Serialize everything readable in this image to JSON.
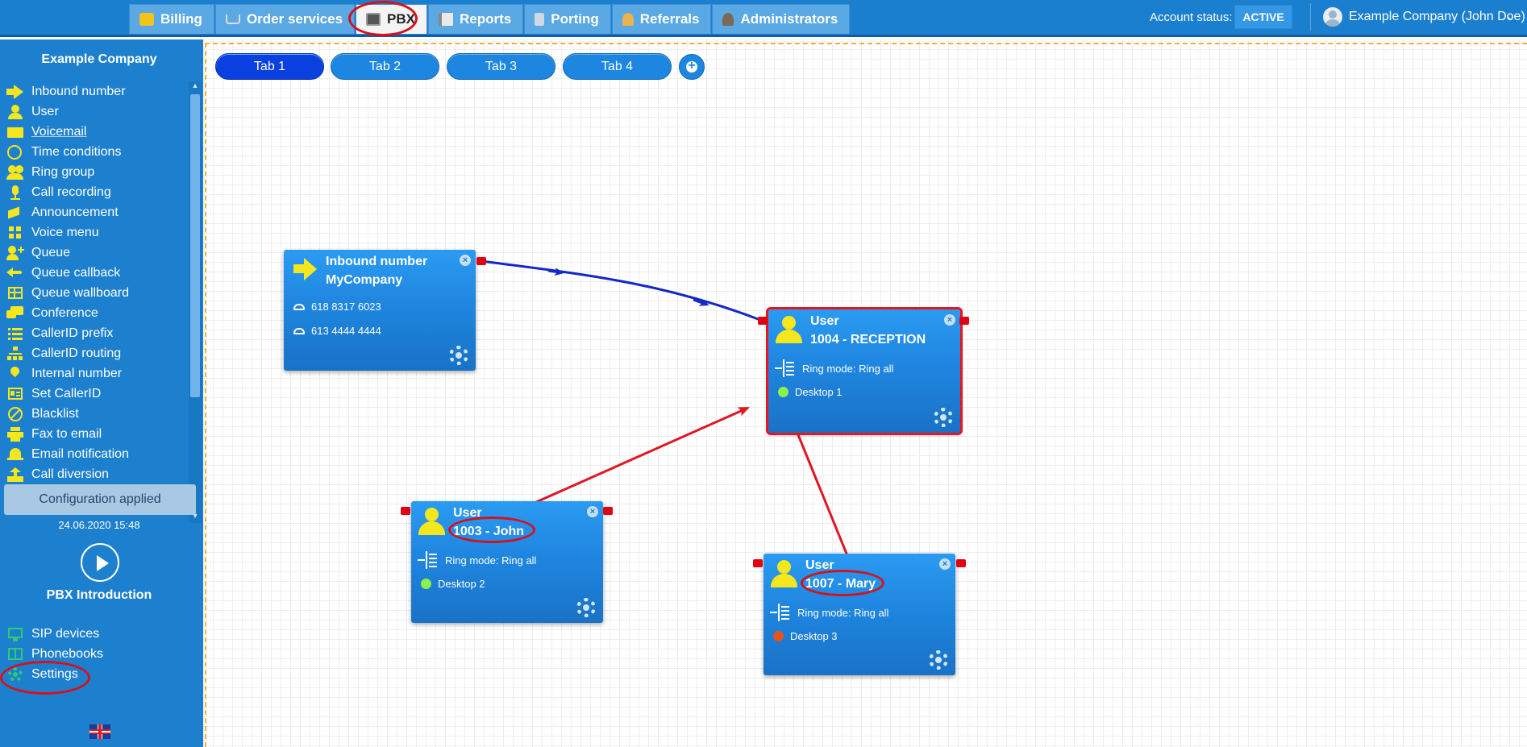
{
  "top_tabs": [
    {
      "label": "Billing",
      "icon": "billing-icon"
    },
    {
      "label": "Order services",
      "icon": "cart-icon"
    },
    {
      "label": "PBX",
      "icon": "pbx-icon"
    },
    {
      "label": "Reports",
      "icon": "reports-icon"
    },
    {
      "label": "Porting",
      "icon": "porting-icon"
    },
    {
      "label": "Referrals",
      "icon": "referrals-icon"
    },
    {
      "label": "Administrators",
      "icon": "administrators-icon"
    }
  ],
  "active_top_tab": "PBX",
  "account": {
    "label": "Account status:",
    "status": "ACTIVE",
    "user": "Example Company (John Doe)"
  },
  "sidebar": {
    "title": "Example Company",
    "items": [
      {
        "label": "Inbound number",
        "icon": "arrow-right-icon"
      },
      {
        "label": "User",
        "icon": "user-icon"
      },
      {
        "label": "Voicemail",
        "icon": "envelope-icon"
      },
      {
        "label": "Time conditions",
        "icon": "clock-icon"
      },
      {
        "label": "Ring group",
        "icon": "users-icon"
      },
      {
        "label": "Call recording",
        "icon": "microphone-icon"
      },
      {
        "label": "Announcement",
        "icon": "megaphone-icon"
      },
      {
        "label": "Voice menu",
        "icon": "grid-icon"
      },
      {
        "label": "Queue",
        "icon": "user-plus-icon"
      },
      {
        "label": "Queue callback",
        "icon": "reply-icon"
      },
      {
        "label": "Queue wallboard",
        "icon": "table-icon"
      },
      {
        "label": "Conference",
        "icon": "chat-icon"
      },
      {
        "label": "CallerID prefix",
        "icon": "list-icon"
      },
      {
        "label": "CallerID routing",
        "icon": "sitemap-icon"
      },
      {
        "label": "Internal number",
        "icon": "map-pin-icon"
      },
      {
        "label": "Set CallerID",
        "icon": "id-card-icon"
      },
      {
        "label": "Blacklist",
        "icon": "ban-icon"
      },
      {
        "label": "Fax to email",
        "icon": "printer-icon"
      },
      {
        "label": "Email notification",
        "icon": "bell-icon"
      },
      {
        "label": "Call diversion",
        "icon": "upload-icon"
      }
    ],
    "config_button": "Configuration applied",
    "config_time": "24.06.2020 15:48",
    "intro_label": "PBX Introduction",
    "bottom_items": [
      {
        "label": "SIP devices",
        "icon": "monitor-icon"
      },
      {
        "label": "Phonebooks",
        "icon": "book-icon"
      },
      {
        "label": "Settings",
        "icon": "gear-icon"
      }
    ],
    "language_icon": "uk-flag-icon"
  },
  "canvas_tabs": [
    "Tab 1",
    "Tab 2",
    "Tab 3",
    "Tab 4"
  ],
  "active_canvas_tab": "Tab 1",
  "nodes": {
    "inbound": {
      "title": "Inbound number",
      "name": "MyCompany",
      "numbers": [
        "618 8317 6023",
        "613 4444 4444"
      ]
    },
    "reception": {
      "title": "User",
      "name": "1004 - RECEPTION",
      "ring_mode": "Ring mode: Ring all",
      "device": "Desktop 1",
      "device_status_color": "#8ef04a"
    },
    "john": {
      "title": "User",
      "name": "1003 - John",
      "ring_mode": "Ring mode: Ring all",
      "device": "Desktop 2",
      "device_status_color": "#8ef04a"
    },
    "mary": {
      "title": "User",
      "name": "1007 - Mary",
      "ring_mode": "Ring mode: Ring all",
      "device": "Desktop 3",
      "device_status_color": "#e8531c"
    }
  },
  "colors": {
    "primary": "#1d80cf",
    "edge_flow": "#1428c8",
    "annotation_red": "#e01720",
    "canvas_border": "#efad3a"
  }
}
